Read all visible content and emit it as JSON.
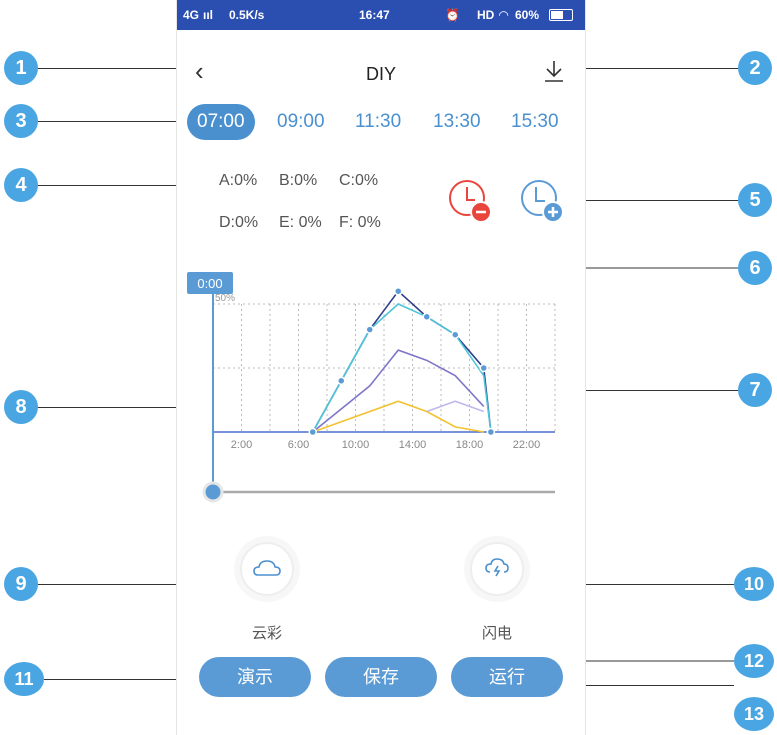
{
  "status": {
    "network": "4G",
    "speed": "0.5K/s",
    "time": "16:47",
    "right": "HD",
    "battery": "60%"
  },
  "header": {
    "title": "DIY"
  },
  "times": [
    "07:00",
    "09:00",
    "11:30",
    "13:30",
    "15:30"
  ],
  "active_time": "07:00",
  "channels": [
    {
      "label": "A:0%"
    },
    {
      "label": "B:0%"
    },
    {
      "label": "C:0%"
    },
    {
      "label": "D:0%"
    },
    {
      "label": "E: 0%"
    },
    {
      "label": "F: 0%"
    }
  ],
  "slider": {
    "label": "0:00",
    "value": 0
  },
  "chart_data": {
    "type": "line",
    "x_ticks": [
      "2:00",
      "6:00",
      "10:00",
      "14:00",
      "18:00",
      "22:00"
    ],
    "y_tick": "50%",
    "xlim": [
      0,
      24
    ],
    "ylim": [
      0,
      100
    ],
    "series": [
      {
        "color": "#2f3f8f",
        "points": [
          [
            7,
            0
          ],
          [
            9,
            20
          ],
          [
            11,
            40
          ],
          [
            13,
            55
          ],
          [
            15,
            45
          ],
          [
            17,
            38
          ],
          [
            19,
            25
          ],
          [
            19.5,
            0
          ]
        ]
      },
      {
        "color": "#4fc6d8",
        "points": [
          [
            7,
            0
          ],
          [
            9,
            20
          ],
          [
            11,
            40
          ],
          [
            13,
            50
          ],
          [
            15,
            45
          ],
          [
            17,
            38
          ],
          [
            19,
            22
          ],
          [
            19.5,
            0
          ]
        ]
      },
      {
        "color": "#7e77c8",
        "points": [
          [
            7,
            0
          ],
          [
            11,
            18
          ],
          [
            13,
            32
          ],
          [
            15,
            28
          ],
          [
            17,
            22
          ],
          [
            19,
            10
          ]
        ]
      },
      {
        "color": "#f2c230",
        "points": [
          [
            7,
            0
          ],
          [
            13,
            12
          ],
          [
            15,
            8
          ],
          [
            17,
            2
          ],
          [
            19,
            0
          ]
        ]
      },
      {
        "color": "#c0b8ea",
        "points": [
          [
            15,
            8
          ],
          [
            17,
            12
          ],
          [
            19,
            8
          ]
        ]
      }
    ]
  },
  "effects": {
    "cloud": "云彩",
    "lightning": "闪电"
  },
  "buttons": {
    "demo": "演示",
    "save": "保存",
    "run": "运行"
  },
  "callouts": [
    "1",
    "2",
    "3",
    "4",
    "5",
    "6",
    "7",
    "8",
    "9",
    "10",
    "11",
    "12",
    "13"
  ],
  "colors": {
    "accent": "#4a90cf",
    "callout": "#4aa6e2",
    "remove": "#e9453d"
  }
}
